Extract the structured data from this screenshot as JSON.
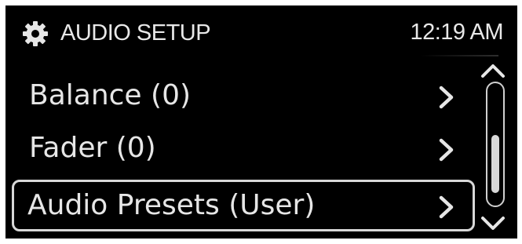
{
  "header": {
    "title": "AUDIO SETUP",
    "time": "12:19 AM",
    "icon": "gear-icon"
  },
  "menu": {
    "items": [
      {
        "label": "Balance (0)",
        "icon": "chevron-right-icon",
        "selected": false
      },
      {
        "label": "Fader (0)",
        "icon": "chevron-right-icon",
        "selected": false
      },
      {
        "label": "Audio Presets (User)",
        "icon": "chevron-right-icon",
        "selected": true
      }
    ]
  },
  "scrollbar": {
    "up_icon": "chevron-up-icon",
    "down_icon": "chevron-down-icon",
    "thumb_start_fraction": 0.42,
    "thumb_length_fraction": 0.5
  },
  "colors": {
    "background": "#000000",
    "text": "#e6e6e6",
    "outline": "#d8d8d8"
  }
}
